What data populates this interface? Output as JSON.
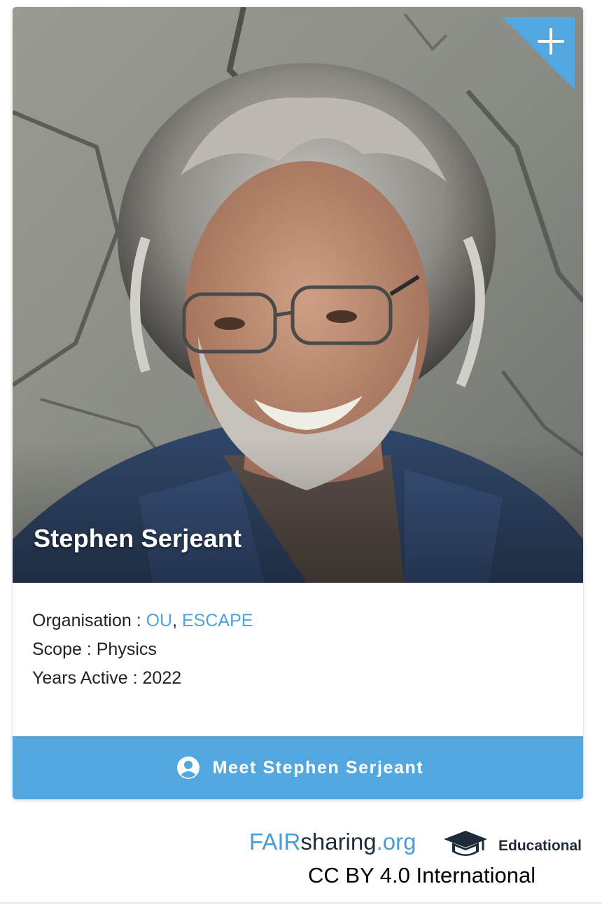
{
  "card": {
    "name": "Stephen Serjeant",
    "add_icon": "plus-icon",
    "organisation_label": "Organisation :",
    "organisations": [
      "OU",
      "ESCAPE"
    ],
    "organisation_separator": ",",
    "scope_label": "Scope :",
    "scope_value": "Physics",
    "years_label": "Years Active :",
    "years_value": "2022",
    "meet_button_label": "Meet Stephen Serjeant",
    "meet_icon": "user-circle-icon"
  },
  "footer": {
    "brand_part1": "FAIR",
    "brand_part2": "sharing",
    "brand_part3": ".org",
    "badge_icon": "graduation-cap-icon",
    "badge_label": "Educational",
    "license": "CC BY 4.0 International"
  },
  "colors": {
    "accent_blue": "#52a8de",
    "link_blue": "#4aa3dc",
    "brand_dark": "#1e2c3a"
  }
}
